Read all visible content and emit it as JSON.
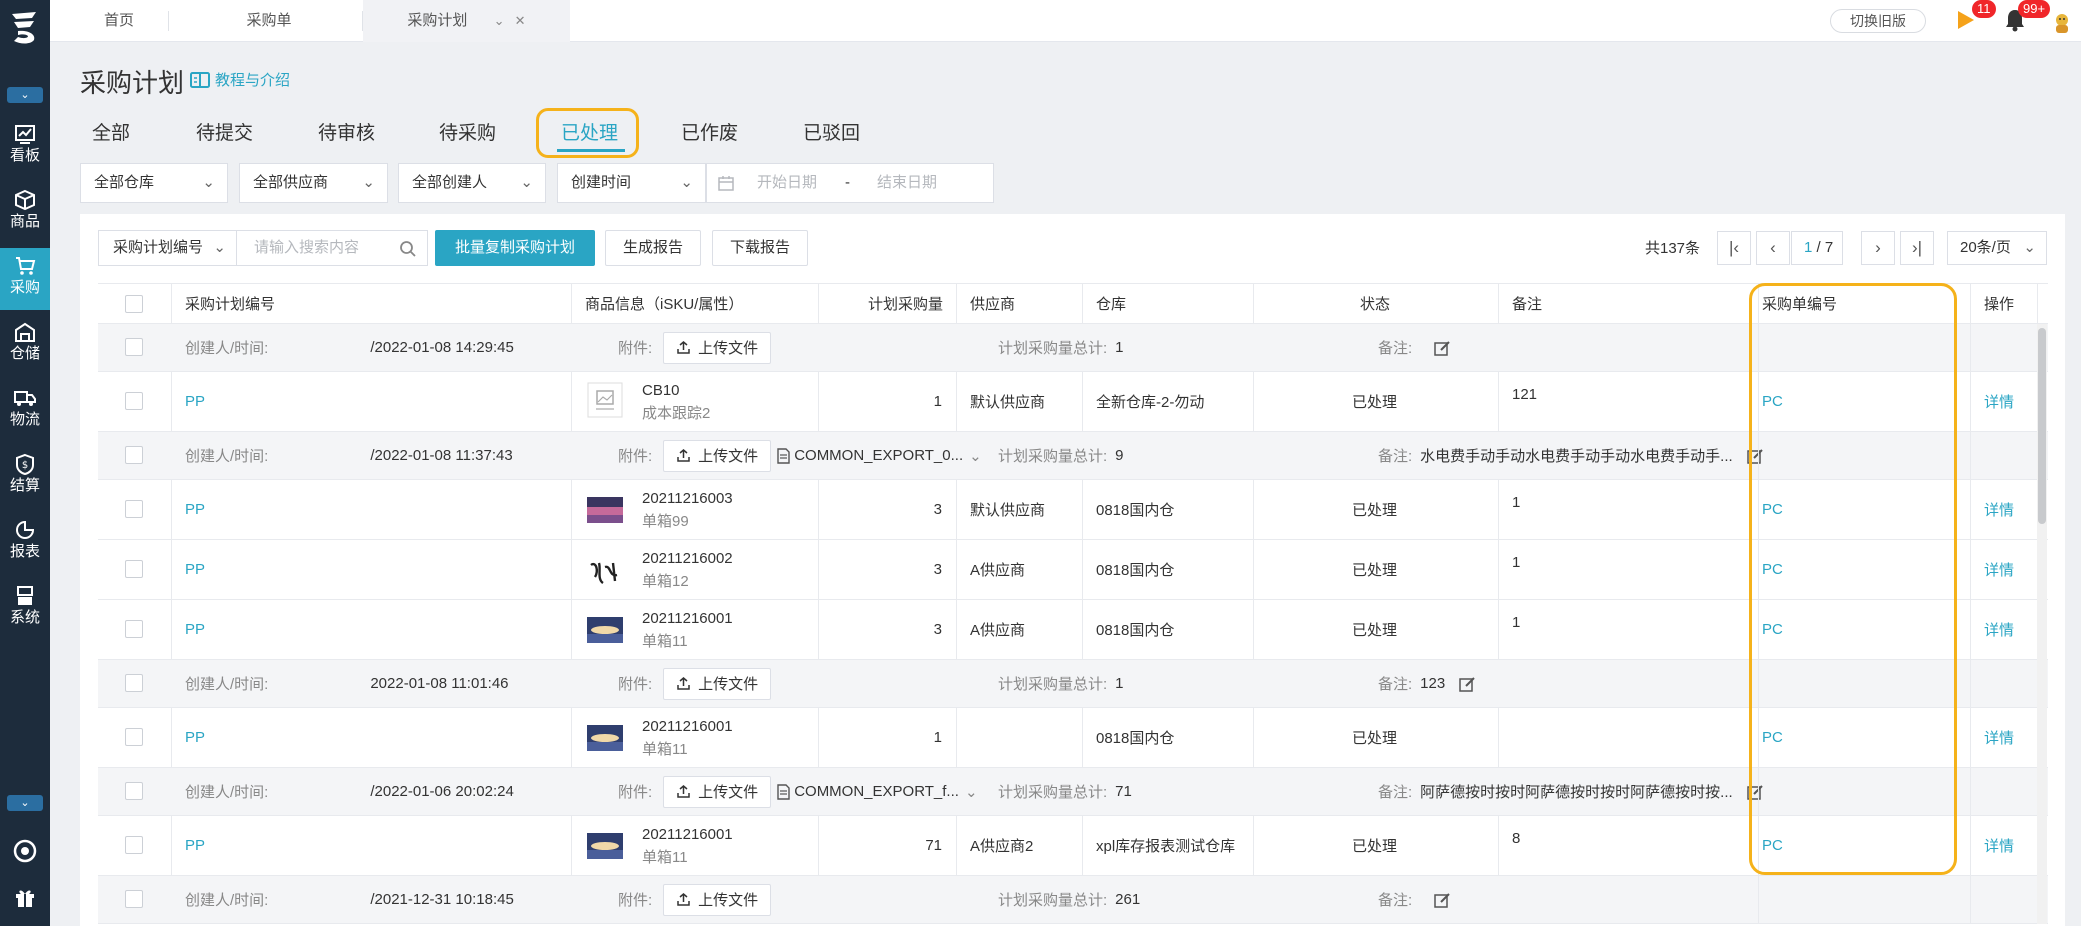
{
  "nav": {
    "items": [
      {
        "label": "看板",
        "icon": "dashboard-icon"
      },
      {
        "label": "商品",
        "icon": "box-icon"
      },
      {
        "label": "采购",
        "icon": "cart-icon"
      },
      {
        "label": "仓储",
        "icon": "warehouse-icon"
      },
      {
        "label": "物流",
        "icon": "truck-icon"
      },
      {
        "label": "结算",
        "icon": "coin-icon"
      },
      {
        "label": "报表",
        "icon": "chart-icon"
      },
      {
        "label": "系统",
        "icon": "system-icon"
      }
    ],
    "active": "采购"
  },
  "topbar": {
    "tabs": [
      "首页",
      "采购单",
      "采购计划"
    ],
    "active_tab": "采购计划",
    "old_version": "切换旧版",
    "flag_badge": "11",
    "bell_badge": "99+"
  },
  "page": {
    "title": "采购计划",
    "tutorial": "教程与介绍"
  },
  "status_tabs": [
    "全部",
    "待提交",
    "待审核",
    "待采购",
    "已处理",
    "已作废",
    "已驳回"
  ],
  "active_status": "已处理",
  "filters": {
    "warehouse": "全部仓库",
    "supplier": "全部供应商",
    "creator": "全部创建人",
    "time_type": "创建时间",
    "start_date": "开始日期",
    "date_sep": "-",
    "end_date": "结束日期"
  },
  "toolbar": {
    "search_field": "采购计划编号",
    "search_placeholder": "请输入搜索内容",
    "batch_copy": "批量复制采购计划",
    "gen_report": "生成报告",
    "download_report": "下载报告"
  },
  "pagination": {
    "total": "共137条",
    "current": "1",
    "pages": "/ 7",
    "page_size": "20条/页"
  },
  "table": {
    "columns": [
      "采购计划编号",
      "商品信息（iSKU/属性）",
      "计划采购量",
      "供应商",
      "仓库",
      "状态",
      "备注",
      "采购单编号",
      "操作"
    ],
    "labels": {
      "created": "创建人/时间:",
      "attachment": "附件:",
      "upload": "上传文件",
      "plan_total": "计划采购量总计:",
      "remark": "备注:",
      "detail": "详情",
      "plan_prefix": "PP",
      "po_prefix": "PC"
    },
    "groups": [
      {
        "created_by": "",
        "datetime": "/2022-01-08 14:29:45",
        "file": "",
        "total": "1",
        "remark": "",
        "items": [
          {
            "plan_no": "",
            "sku": "CB10",
            "attr": "成本跟踪2",
            "qty": "1",
            "supplier": "默认供应商",
            "warehouse": "全新仓库-2-勿动",
            "status": "已处理",
            "note": "121",
            "po_no": "",
            "img": "placeholder"
          }
        ]
      },
      {
        "created_by": "",
        "datetime": "/2022-01-08 11:37:43",
        "file": "COMMON_EXPORT_0...",
        "total": "9",
        "remark": "水电费手动手动水电费手动手动水电费手动手...",
        "items": [
          {
            "plan_no": "",
            "sku": "20211216003",
            "attr": "单箱99",
            "qty": "3",
            "supplier": "默认供应商",
            "warehouse": "0818国内仓",
            "status": "已处理",
            "note": "1",
            "po_no": "",
            "img": "purple"
          },
          {
            "plan_no": "",
            "sku": "20211216002",
            "attr": "单箱12",
            "qty": "3",
            "supplier": "A供应商",
            "warehouse": "0818国内仓",
            "status": "已处理",
            "note": "1",
            "po_no": "",
            "img": "calligraphy"
          },
          {
            "plan_no": "",
            "sku": "20211216001",
            "attr": "单箱11",
            "qty": "3",
            "supplier": "A供应商",
            "warehouse": "0818国内仓",
            "status": "已处理",
            "note": "1",
            "po_no": "",
            "img": "blue"
          }
        ]
      },
      {
        "created_by": "",
        "datetime": "2022-01-08 11:01:46",
        "file": "",
        "total": "1",
        "remark": "123",
        "items": [
          {
            "plan_no": "",
            "sku": "20211216001",
            "attr": "单箱11",
            "qty": "1",
            "supplier": "",
            "warehouse": "0818国内仓",
            "status": "已处理",
            "note": "",
            "po_no": "",
            "img": "blue"
          }
        ]
      },
      {
        "created_by": "",
        "datetime": "/2022-01-06 20:02:24",
        "file": "COMMON_EXPORT_f...",
        "total": "71",
        "remark": "阿萨德按时按时阿萨德按时按时阿萨德按时按...",
        "items": [
          {
            "plan_no": "",
            "sku": "20211216001",
            "attr": "单箱11",
            "qty": "71",
            "supplier": "A供应商2",
            "warehouse": "xpl库存报表测试仓库",
            "status": "已处理",
            "note": "8",
            "po_no": "",
            "img": "blue"
          }
        ]
      },
      {
        "created_by": "",
        "datetime": "/2021-12-31 10:18:45",
        "file": "",
        "total": "261",
        "remark": "",
        "items": []
      }
    ]
  },
  "colors": {
    "accent": "#2aa5c4",
    "sidebar": "#1d2c3c",
    "highlight": "#f5b21a",
    "badge": "#f0262a"
  }
}
